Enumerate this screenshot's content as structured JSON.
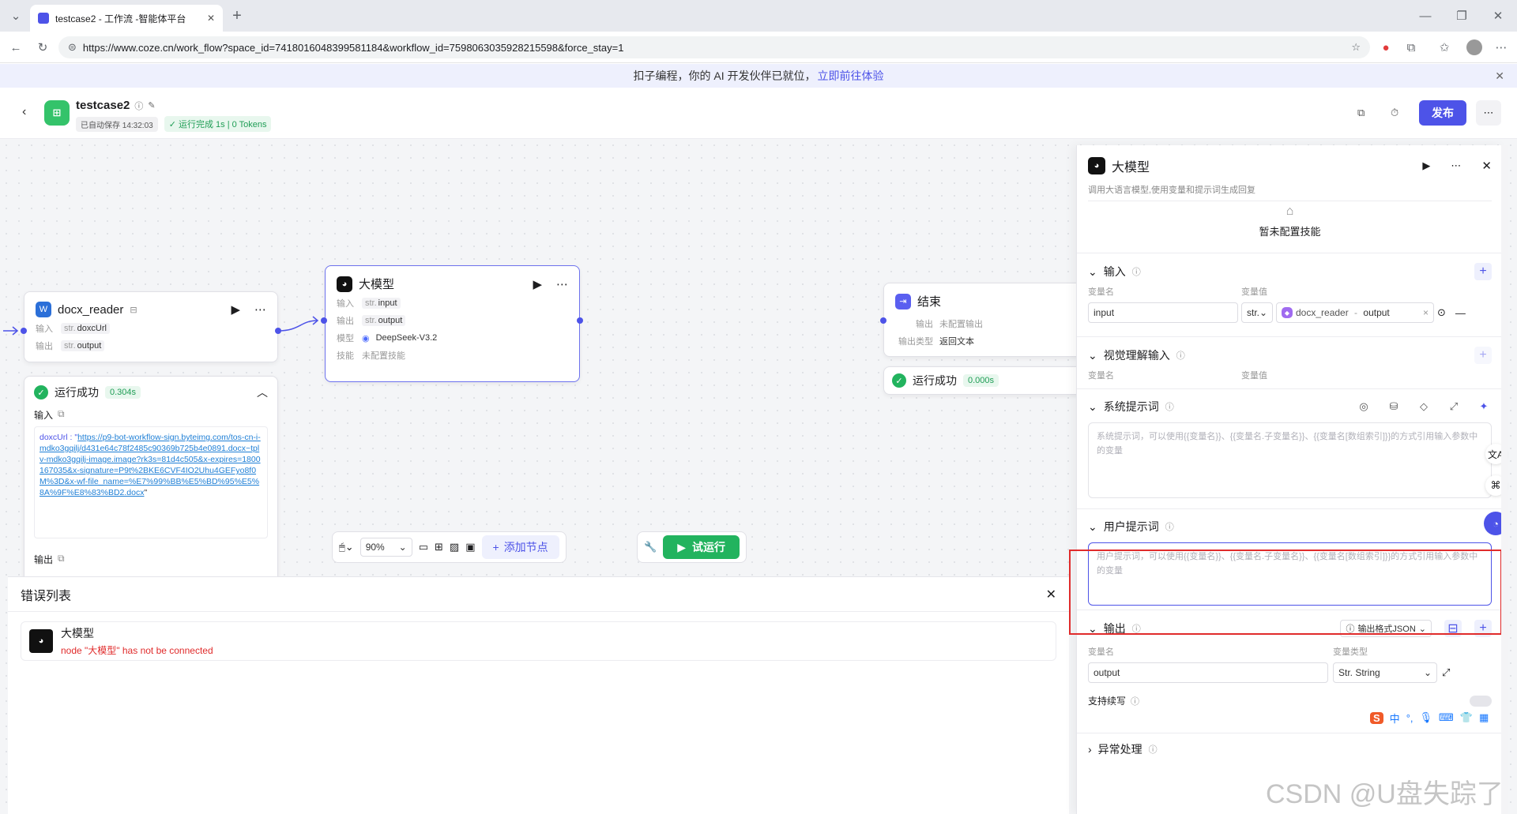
{
  "browser": {
    "tab_title": "testcase2 - 工作流 -智能体平台",
    "url": "https://www.coze.cn/work_flow?space_id=7418016048399581184&workflow_id=7598063035928215598&force_stay=1"
  },
  "banner": {
    "text": "扣子编程，你的 AI 开发伙伴已就位，",
    "link": "立即前往体验"
  },
  "header": {
    "title": "testcase2",
    "autosave": "已自动保存 14:32:03",
    "run_status": "运行完成 1s | 0 Tokens",
    "publish_label": "发布"
  },
  "nodes": {
    "docx_reader": {
      "title": "docx_reader",
      "input_label": "输入",
      "input_type": "str.",
      "input_value": "doxcUrl",
      "output_label": "输出",
      "output_type": "str.",
      "output_value": "output"
    },
    "docx_result": {
      "status": "运行成功",
      "time": "0.304s",
      "input_heading": "输入",
      "input_key": "doxcUrl : \"",
      "input_link": "https://p9-bot-workflow-sign.byteimg.com/tos-cn-i-mdko3gqilj/d431e64c78f2485c90369b725b4e0891.docx~tplv-mdko3gqilj-image.image?rk3s=81d4c505&x-expires=1800167035&x-signature=P9t%2BKE6CVF4IO2Uhu4GEFyo8f0M%3D&x-wf-file_name=%E7%99%BB%E5%BD%95%E5%8A%9F%E8%83%BD2.docx",
      "input_tail": "\"",
      "output_heading": "输出"
    },
    "llm": {
      "title": "大模型",
      "input_label": "输入",
      "input_type": "str.",
      "input_value": "input",
      "output_label": "输出",
      "output_type": "str.",
      "output_value": "output",
      "model_label": "模型",
      "model_value": "DeepSeek-V3.2",
      "skill_label": "技能",
      "skill_value": "未配置技能"
    },
    "end": {
      "title": "结束",
      "output_label": "输出",
      "output_value": "未配置输出",
      "type_label": "输出类型",
      "type_value": "返回文本",
      "status": "运行成功",
      "time": "0.000s"
    }
  },
  "toolbar": {
    "zoom": "90%",
    "add_node": "添加节点",
    "run": "试运行"
  },
  "errors": {
    "title": "错误列表",
    "item_title": "大模型",
    "item_message": "node \"大模型\" has not be connected"
  },
  "panel": {
    "title": "大模型",
    "description": "调用大语言模型,使用变量和提示词生成回复",
    "no_skill": "暂未配置技能",
    "input_section": "输入",
    "var_name_header": "变量名",
    "var_value_header": "变量值",
    "input_var_name": "input",
    "input_var_type": "str.",
    "input_ref_node": "docx_reader",
    "input_ref_sep": " - ",
    "input_ref_field": "output",
    "vision_section": "视觉理解输入",
    "system_prompt_section": "系统提示词",
    "system_prompt_placeholder": "系统提示词，可以使用{{变量名}}、{{变量名.子变量名}}、{{变量名[数组索引]}}的方式引用输入参数中的变量",
    "user_prompt_section": "用户提示词",
    "user_prompt_placeholder": "用户提示词，可以使用{{变量名}}、{{变量名.子变量名}}、{{变量名[数组索引]}}的方式引用输入参数中的变量",
    "output_section": "输出",
    "output_format": "输出格式JSON",
    "out_name_header": "变量名",
    "out_type_header": "变量类型",
    "output_var_name": "output",
    "output_var_type": "Str. String",
    "streaming_label": "支持续写",
    "exception_section": "异常处理"
  },
  "watermark": "CSDN @U盘失踪了",
  "ime": {
    "label": "中"
  },
  "colors": {
    "accent": "#4d53e8",
    "success": "#22b35e",
    "error": "#e02b2b"
  }
}
